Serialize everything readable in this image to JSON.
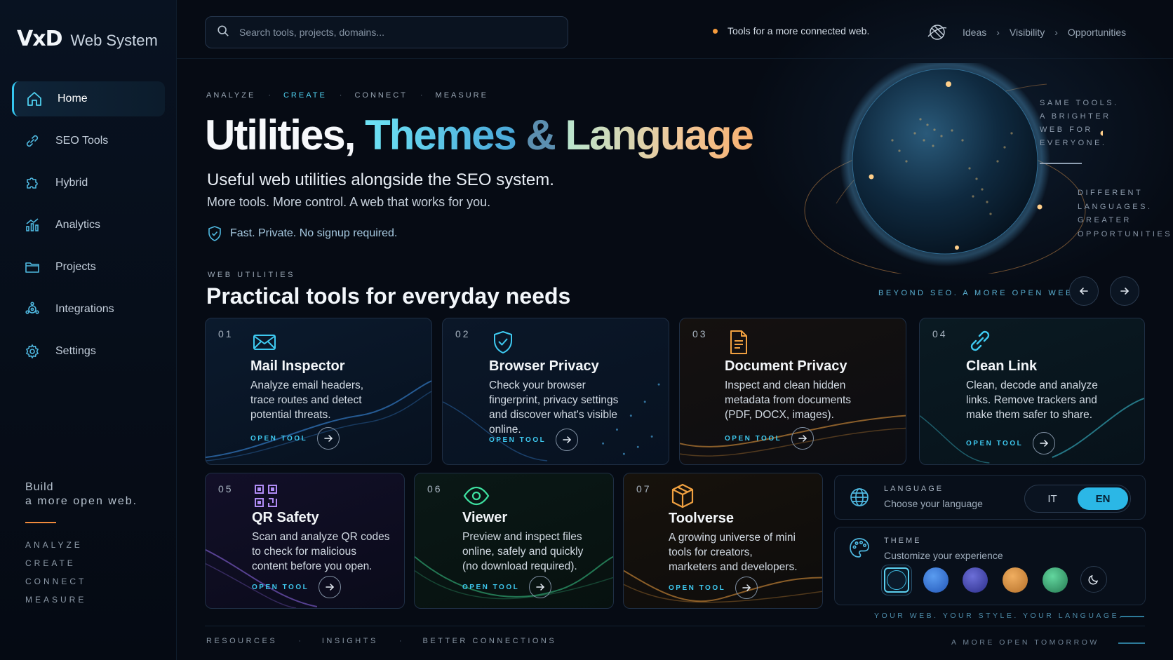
{
  "brand": {
    "mark": "VxD",
    "name": "Web System"
  },
  "sidebar": {
    "items": [
      {
        "label": "Home",
        "icon": "home-icon",
        "active": true
      },
      {
        "label": "SEO Tools",
        "icon": "link-icon"
      },
      {
        "label": "Hybrid",
        "icon": "puzzle-icon"
      },
      {
        "label": "Analytics",
        "icon": "chart-icon"
      },
      {
        "label": "Projects",
        "icon": "folder-icon"
      },
      {
        "label": "Integrations",
        "icon": "nodes-icon"
      },
      {
        "label": "Settings",
        "icon": "gear-icon"
      }
    ],
    "footer": {
      "line1": "Build",
      "line2": "a more open web.",
      "words": [
        "ANALYZE",
        "CREATE",
        "CONNECT",
        "MEASURE"
      ]
    }
  },
  "search": {
    "placeholder": "Search tools, projects, domains..."
  },
  "header": {
    "tagline": "Tools for a more connected web.",
    "breadcrumbs": [
      "Ideas",
      "Visibility",
      "Opportunities"
    ]
  },
  "hero": {
    "pills": [
      "ANALYZE",
      "CREATE",
      "CONNECT",
      "MEASURE"
    ],
    "title_a": "Utilities,",
    "title_b": "Themes",
    "title_amp": "&",
    "title_c": "Language",
    "subtitle": "Useful web utilities alongside the SEO system.",
    "subtitle2": "More tools. More control. A web that works for you.",
    "badge": "Fast. Private. No signup required.",
    "note1": [
      "SAME TOOLS.",
      "A BRIGHTER",
      "WEB FOR",
      "EVERYONE."
    ],
    "note2": [
      "DIFFERENT",
      "LANGUAGES.",
      "GREATER",
      "OPPORTUNITIES."
    ]
  },
  "section": {
    "label": "WEB UTILITIES",
    "title": "Practical tools for everyday needs",
    "right": "BEYOND SEO. A MORE OPEN WEB."
  },
  "cards": [
    {
      "num": "01",
      "title": "Mail Inspector",
      "desc": "Analyze email headers, trace routes and detect potential threats.",
      "cta": "OPEN TOOL",
      "icon": "mail-icon",
      "accent": "#3ec9f0"
    },
    {
      "num": "02",
      "title": "Browser Privacy",
      "desc": "Check your browser fingerprint, privacy settings and discover what's visible online.",
      "cta": "OPEN TOOL",
      "icon": "shield-icon",
      "accent": "#3ec9f0"
    },
    {
      "num": "03",
      "title": "Document Privacy",
      "desc": "Inspect and clean hidden metadata from documents (PDF, DOCX, images).",
      "cta": "OPEN TOOL",
      "icon": "document-icon",
      "accent": "#f0a040"
    },
    {
      "num": "04",
      "title": "Clean Link",
      "desc": "Clean, decode and analyze links. Remove trackers and make them safer to share.",
      "cta": "OPEN TOOL",
      "icon": "chain-link-icon",
      "accent": "#3ec9f0"
    },
    {
      "num": "05",
      "title": "QR Safety",
      "desc": "Scan and analyze QR codes to check for malicious content before you open.",
      "cta": "OPEN TOOL",
      "icon": "qr-code-icon",
      "accent": "#a07cf0"
    },
    {
      "num": "06",
      "title": "Viewer",
      "desc": "Preview and inspect files online, safely and quickly (no download required).",
      "cta": "OPEN TOOL",
      "icon": "eye-icon",
      "accent": "#3ee0a0"
    },
    {
      "num": "07",
      "title": "Toolverse",
      "desc": "A growing universe of mini tools for creators, marketers and developers.",
      "cta": "OPEN TOOL",
      "icon": "cube-icon",
      "accent": "#f0a040"
    }
  ],
  "language": {
    "label": "LANGUAGE",
    "sub": "Choose your language",
    "options": [
      "IT",
      "EN"
    ],
    "selected": "EN"
  },
  "theme": {
    "label": "THEME",
    "sub": "Customize your experience",
    "swatches": [
      "#0b1a2a",
      "#2f6fd6",
      "#3a3da8",
      "#d98b3a",
      "#38a874"
    ],
    "selected_index": 0
  },
  "tagline2": "YOUR WEB. YOUR STYLE. YOUR LANGUAGE.",
  "footer": {
    "links": [
      "RESOURCES",
      "INSIGHTS",
      "BETTER CONNECTIONS"
    ],
    "right": "A MORE OPEN TOMORROW"
  }
}
